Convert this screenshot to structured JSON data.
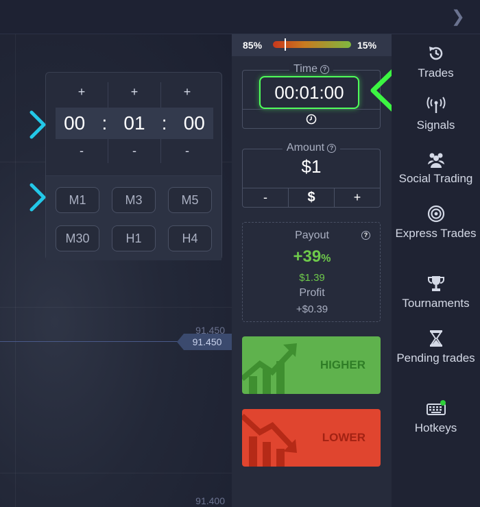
{
  "sentiment": {
    "left_pct": "85%",
    "right_pct": "15%",
    "left_value": 0.85
  },
  "picker": {
    "plus": [
      "+",
      "+",
      "+"
    ],
    "minus": [
      "-",
      "-",
      "-"
    ],
    "hours": "00",
    "minutes": "01",
    "seconds": "00",
    "separator": ":",
    "presets": [
      "M1",
      "M3",
      "M5",
      "M30",
      "H1",
      "H4"
    ]
  },
  "time": {
    "label": "Time",
    "value": "00:01:00",
    "info": "?"
  },
  "amount": {
    "label": "Amount",
    "value": "$1",
    "minus": "-",
    "currency": "$",
    "plus": "+",
    "info": "?"
  },
  "payout": {
    "label": "Payout",
    "percent": "+39",
    "percent_sign": "%",
    "amount": "$1.39",
    "profit_label": "Profit",
    "profit_value": "+$0.39",
    "info": "?"
  },
  "buttons": {
    "higher": "HIGHER",
    "lower": "LOWER"
  },
  "chart": {
    "price_tag": "91.450",
    "axis_labels": [
      "91.450",
      "91.400"
    ]
  },
  "nav": [
    {
      "label": "Trades",
      "icon": "history-icon"
    },
    {
      "label": "Signals",
      "icon": "antenna-icon"
    },
    {
      "label": "Social Trading",
      "icon": "users-icon"
    },
    {
      "label": "Express Trades",
      "icon": "target-icon"
    },
    {
      "label": "Tournaments",
      "icon": "trophy-icon"
    },
    {
      "label": "Pending trades",
      "icon": "hourglass-icon"
    },
    {
      "label": "Hotkeys",
      "icon": "keyboard-icon"
    }
  ],
  "colors": {
    "accent_green": "#4fff5a",
    "cyan_arrow": "#23c8e8",
    "higher": "#5fb24d",
    "lower": "#e0452f"
  }
}
